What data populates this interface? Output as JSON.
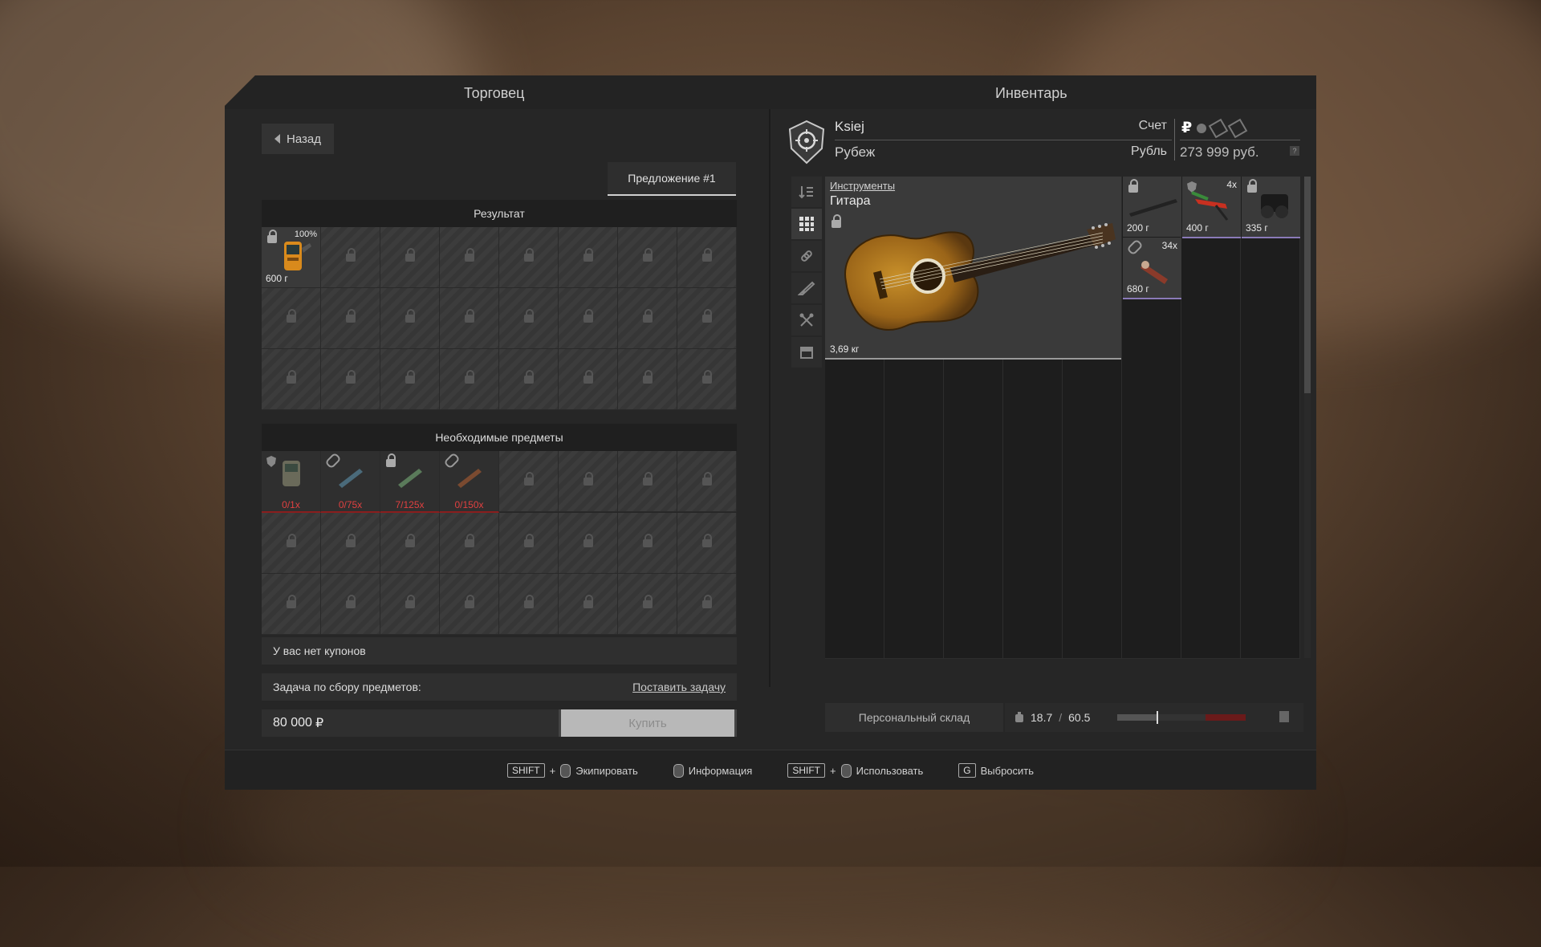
{
  "trader": {
    "title": "Торговец",
    "back_label": "Назад",
    "offer_tab": "Предложение #1",
    "result_header": "Результат",
    "result_item": {
      "weight": "600 г",
      "condition": "100%"
    },
    "required_header": "Необходимые предметы",
    "required_items": [
      {
        "count": "0/1x"
      },
      {
        "count": "0/75x"
      },
      {
        "count": "7/125x"
      },
      {
        "count": "0/150x"
      }
    ],
    "coupons_text": "У вас нет купонов",
    "task_label": "Задача по сбору предметов:",
    "task_action": "Поставить задачу",
    "price": "80 000",
    "currency_symbol": "₽",
    "buy_label": "Купить"
  },
  "inventory": {
    "title": "Инвентарь",
    "player_name": "Ksiej",
    "faction": "Рубеж",
    "account_label": "Счет",
    "currency_label": "Рубль",
    "money": "273 999 руб.",
    "money_help": "?",
    "selected_item": {
      "category": "Инструменты",
      "name": "Гитара",
      "weight": "3,69 кг"
    },
    "items": [
      {
        "weight": "200 г"
      },
      {
        "weight": "400 г",
        "stack": "4x"
      },
      {
        "weight": "335 г"
      },
      {
        "weight": "680 г",
        "stack": "34x"
      }
    ],
    "storage_label": "Персональный склад",
    "weight_current": "18.7",
    "weight_sep": "/",
    "weight_max": "60.5",
    "weight_fraction": 0.309
  },
  "footer": {
    "hints": [
      {
        "key": "SHIFT",
        "plus": "+",
        "label": "Экипировать"
      },
      {
        "label": "Информация"
      },
      {
        "key": "SHIFT",
        "plus": "+",
        "label": "Использовать"
      },
      {
        "key": "G",
        "label": "Выбросить"
      }
    ]
  },
  "colors": {
    "accent_red": "#e04040",
    "panel": "#262626",
    "rarity_purple": "#8a7ab8"
  }
}
